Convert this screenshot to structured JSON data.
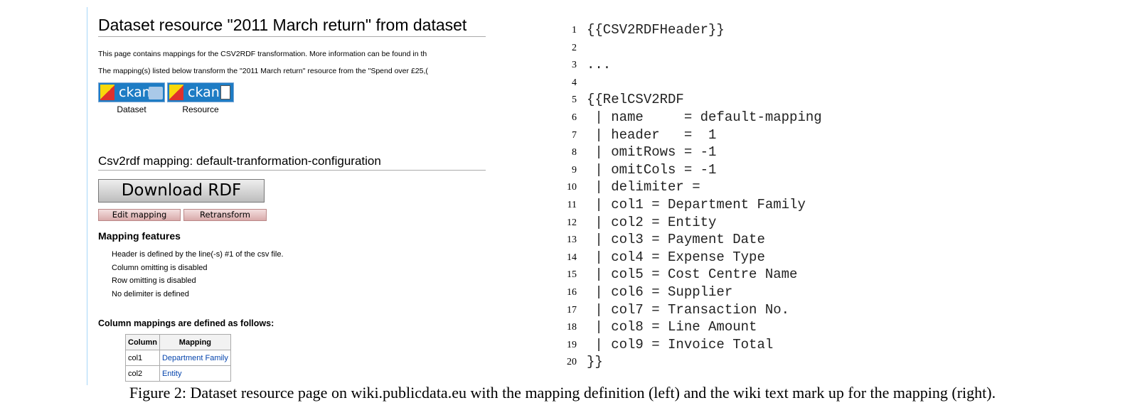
{
  "wiki": {
    "page_title": "Dataset resource \"2011 March return\" from dataset",
    "intro1": "This page contains mappings for the CSV2RDF transformation. More information can be found in th",
    "intro2": "The mapping(s) listed below transform the \"2011 March return\" resource from the \"Spend over £25,(",
    "ckan_text": "ckan",
    "dataset_caption": "Dataset",
    "resource_caption": "Resource",
    "section_title": "Csv2rdf mapping: default-tranformation-configuration",
    "download_label": "Download RDF",
    "edit_label": "Edit mapping",
    "retransform_label": "Retransform",
    "features_title": "Mapping features",
    "features": [
      "Header is defined by the line(-s) #1 of the csv file.",
      "Column omitting is disabled",
      "Row omitting is disabled",
      "No delimiter is defined"
    ],
    "colmap_title": "Column mappings are defined as follows:",
    "table_headers": [
      "Column",
      "Mapping"
    ],
    "table_rows": [
      {
        "column": "col1",
        "mapping": "Department Family"
      },
      {
        "column": "col2",
        "mapping": "Entity"
      }
    ]
  },
  "code_lines": [
    {
      "n": "1",
      "text": "{{CSV2RDFHeader}}"
    },
    {
      "n": "2",
      "text": ""
    },
    {
      "n": "3",
      "text": "..."
    },
    {
      "n": "4",
      "text": ""
    },
    {
      "n": "5",
      "text": "{{RelCSV2RDF"
    },
    {
      "n": "6",
      "text": " | name     = default-mapping"
    },
    {
      "n": "7",
      "text": " | header   =  1"
    },
    {
      "n": "8",
      "text": " | omitRows = -1"
    },
    {
      "n": "9",
      "text": " | omitCols = -1"
    },
    {
      "n": "10",
      "text": " | delimiter ="
    },
    {
      "n": "11",
      "text": " | col1 = Department Family"
    },
    {
      "n": "12",
      "text": " | col2 = Entity"
    },
    {
      "n": "13",
      "text": " | col3 = Payment Date"
    },
    {
      "n": "14",
      "text": " | col4 = Expense Type"
    },
    {
      "n": "15",
      "text": " | col5 = Cost Centre Name"
    },
    {
      "n": "16",
      "text": " | col6 = Supplier"
    },
    {
      "n": "17",
      "text": " | col7 = Transaction No."
    },
    {
      "n": "18",
      "text": " | col8 = Line Amount"
    },
    {
      "n": "19",
      "text": " | col9 = Invoice Total"
    },
    {
      "n": "20",
      "text": "}}"
    }
  ],
  "caption": "Figure 2: Dataset resource page on wiki.publicdata.eu with the mapping definition (left) and the wiki text mark up for the mapping (right)."
}
